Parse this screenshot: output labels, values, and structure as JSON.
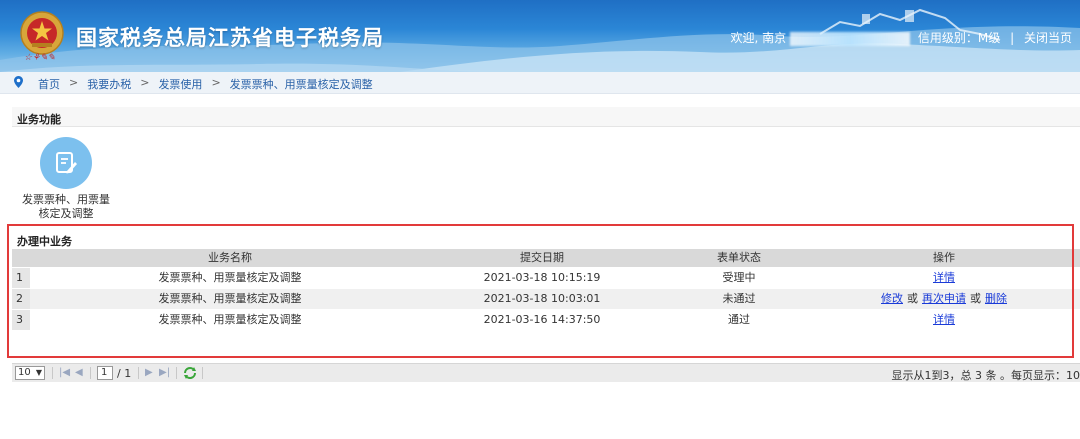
{
  "header": {
    "site_title": "国家税务总局江苏省电子税务局",
    "welcome_prefix": "欢迎, 南京",
    "credit_level": "信用级别：M级",
    "close_link": "关闭当页"
  },
  "breadcrumb": {
    "items": [
      "首页",
      "我要办税",
      "发票使用",
      "发票票种、用票量核定及调整"
    ],
    "separator": ">"
  },
  "function_section": {
    "title": "业务功能",
    "tiles": [
      {
        "label": "发票票种、用票量核定及调整",
        "icon": "edit-document-icon"
      }
    ]
  },
  "pending_section": {
    "title": "办理中业务",
    "columns": [
      "业务名称",
      "提交日期",
      "表单状态",
      "操作"
    ],
    "rows": [
      {
        "num": "1",
        "name": "发票票种、用票量核定及调整",
        "date": "2021-03-18 10:15:19",
        "status": "受理中",
        "ops": [
          "详情"
        ]
      },
      {
        "num": "2",
        "name": "发票票种、用票量核定及调整",
        "date": "2021-03-18 10:03:01",
        "status": "未通过",
        "ops": [
          "修改",
          "再次申请",
          "删除"
        ],
        "or": "或"
      },
      {
        "num": "3",
        "name": "发票票种、用票量核定及调整",
        "date": "2021-03-16 14:37:50",
        "status": "通过",
        "ops": [
          "详情"
        ]
      }
    ]
  },
  "pager": {
    "page_size": "10",
    "current_page": "1",
    "total_pages": "/ 1",
    "info": "显示从1到3，总 3 条 。每页显示：10"
  },
  "colors": {
    "banner_top": "#1f6fc4",
    "link_blue": "#1a3bd8",
    "highlight_red": "#e23a3a",
    "tile_circle": "#7cc0ee"
  }
}
